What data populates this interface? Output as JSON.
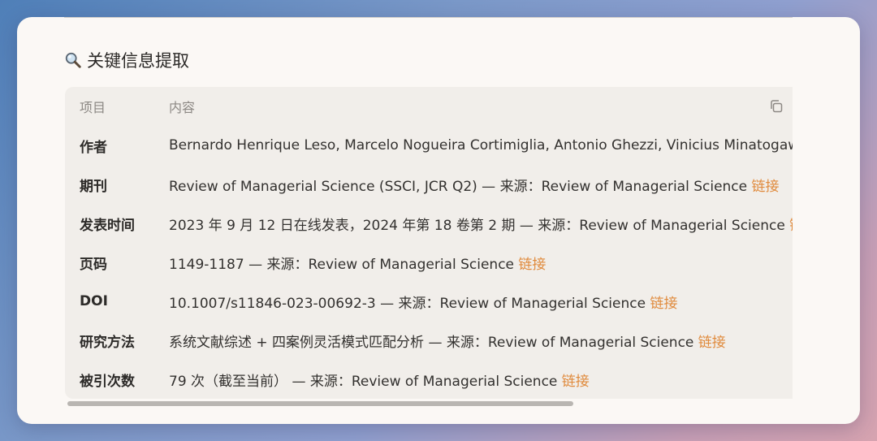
{
  "heading": {
    "icon": "magnifier-icon",
    "title": "关键信息提取"
  },
  "table": {
    "headers": [
      "项目",
      "内容"
    ],
    "copy_icon": "copy-icon",
    "link_color": "#e08a3c",
    "rows": [
      {
        "label": "作者",
        "text": "Bernardo Henrique Leso, Marcelo Nogueira Cortimiglia, Antonio Ghezzi, Vinicius Minatogawa",
        "link": ""
      },
      {
        "label": "期刊",
        "text": "Review of Managerial Science (SSCI, JCR Q2) — 来源：Review of Managerial Science ",
        "link": "链接"
      },
      {
        "label": "发表时间",
        "text": "2023 年 9 月 12 日在线发表，2024 年第 18 卷第 2 期 — 来源：Review of Managerial Science ",
        "link": "链接"
      },
      {
        "label": "页码",
        "text": "1149-1187 — 来源：Review of Managerial Science ",
        "link": "链接"
      },
      {
        "label": "DOI",
        "text": "10.1007/s11846-023-00692-3 — 来源：Review of Managerial Science ",
        "link": "链接"
      },
      {
        "label": "研究方法",
        "text": "系统文献综述 + 四案例灵活模式匹配分析 — 来源：Review of Managerial Science ",
        "link": "链接"
      },
      {
        "label": "被引次数",
        "text": "79 次（截至当前） — 来源：Review of Managerial Science ",
        "link": "链接"
      }
    ]
  },
  "scrollbar": {
    "position_fraction": 0,
    "visible_fraction": 0.7
  }
}
